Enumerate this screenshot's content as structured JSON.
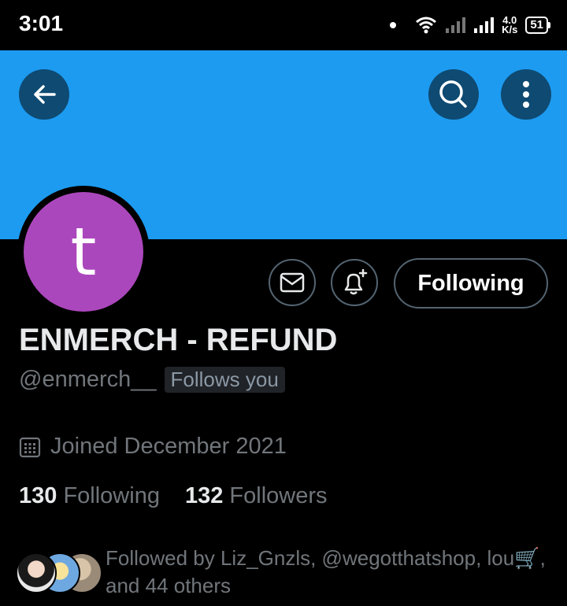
{
  "status_bar": {
    "time": "3:01",
    "net_speed_value": "4.0",
    "net_speed_unit": "K/s",
    "battery": "51"
  },
  "banner": {
    "color": "#1d9bf0"
  },
  "toolbar": {
    "back_icon": "back-arrow-icon",
    "search_icon": "search-icon",
    "more_icon": "more-vertical-icon"
  },
  "profile": {
    "avatar_letter": "t",
    "avatar_color": "#ab47bc",
    "name": "ENMERCH - REFUND",
    "handle": "@enmerch__",
    "follows_you": "Follows you",
    "joined": "Joined December 2021",
    "following_count": "130",
    "following_label": "Following",
    "followers_count": "132",
    "followers_label": "Followers",
    "follow_button": "Following",
    "followed_by_line1": "Followed by Liz_Gnzls, @wegotthatshop, lou🛒,",
    "followed_by_line2": "and 44 others"
  }
}
